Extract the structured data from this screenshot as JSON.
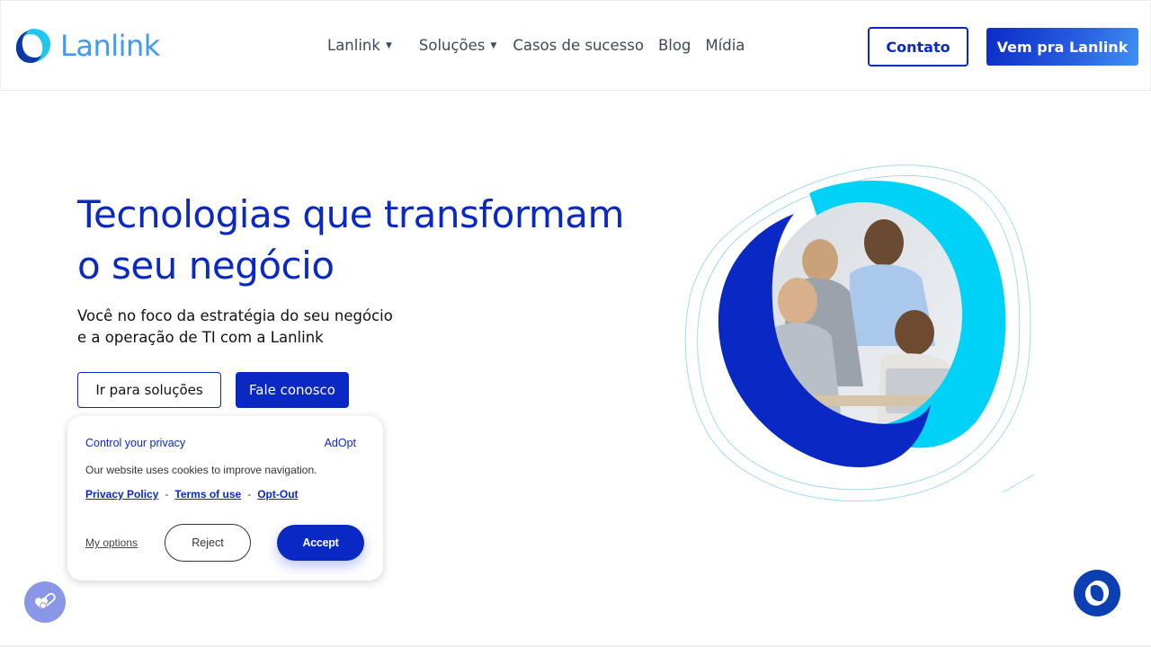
{
  "header": {
    "logo_text": "Lanlink",
    "nav": [
      {
        "label": "Lanlink",
        "has_dropdown": true
      },
      {
        "label": "Soluções",
        "has_dropdown": true
      },
      {
        "label": "Casos de sucesso",
        "has_dropdown": false
      },
      {
        "label": "Blog",
        "has_dropdown": false
      },
      {
        "label": "Mídia",
        "has_dropdown": false
      }
    ],
    "caret": "▼",
    "contato_label": "Contato",
    "vem_label": "Vem pra Lanlink"
  },
  "hero": {
    "title_line1": "Tecnologias que transformam",
    "title_line2": "o seu negócio",
    "subtitle_line1": "Você no foco da estratégia do seu negócio",
    "subtitle_line2": "e a operação de TI com a Lanlink",
    "btn_solutions": "Ir para soluções",
    "btn_contact": "Fale conosco",
    "image_alt": "team-working-on-laptop"
  },
  "cookie": {
    "title": "Control your privacy",
    "brand": "AdOpt",
    "text": "Our website uses cookies to improve navigation.",
    "links": [
      "Privacy Policy",
      "Terms of use",
      "Opt-Out"
    ],
    "separator": "-",
    "options_label": "My options",
    "reject_label": "Reject",
    "accept_label": "Accept"
  },
  "colors": {
    "primary": "#0a28c4",
    "logo_light": "#3f9af2",
    "cyan": "#00d2f7",
    "nav_text": "#3d4a5a",
    "privacy_fab": "#8a96e8",
    "chat_fab": "#0b3fb2"
  },
  "icons": {
    "privacy_fab": "privacy-toggle-icon",
    "chat_fab": "lanlink-chat-icon"
  }
}
